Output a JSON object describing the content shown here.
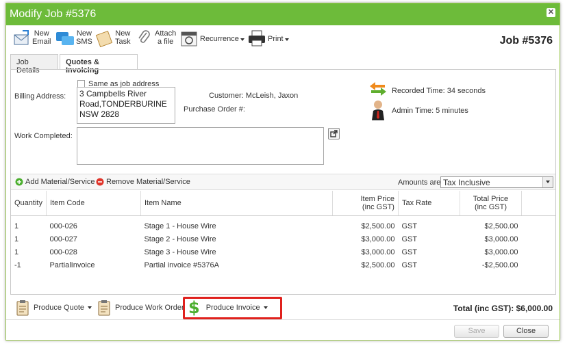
{
  "window": {
    "title": "Modify Job #5376",
    "close_symbol": "✕"
  },
  "toolbar": {
    "new_email": [
      "New",
      "Email"
    ],
    "new_sms": [
      "New",
      "SMS"
    ],
    "new_task": [
      "New",
      "Task"
    ],
    "attach": [
      "Attach",
      "a file"
    ],
    "recurrence": "Recurrence",
    "print": "Print",
    "job_number": "Job #5376"
  },
  "tabs": [
    {
      "label": "Job Details"
    },
    {
      "label": "Quotes & Invoicing"
    }
  ],
  "form": {
    "same_as_job_address": "Same as job address",
    "billing_address_label": "Billing Address:",
    "billing_address_lines": [
      "3 Campbells River",
      "Road,TONDERBURINE",
      "NSW 2828"
    ],
    "customer": "Customer: McLeish, Jaxon",
    "purchase_order": "Purchase Order #:",
    "work_completed_label": "Work Completed:",
    "recorded_time": "Recorded Time: 34 seconds",
    "admin_time": "Admin Time: 5 minutes"
  },
  "materials": {
    "add": "Add Material/Service",
    "remove": "Remove Material/Service",
    "amounts_label": "Amounts are",
    "amounts_value": "Tax Inclusive"
  },
  "table": {
    "headers": {
      "quantity": "Quantity",
      "item_code": "Item Code",
      "item_name": "Item Name",
      "item_price_1": "Item Price",
      "item_price_2": "(inc GST)",
      "tax_rate": "Tax Rate",
      "total_price_1": "Total Price",
      "total_price_2": "(inc GST)"
    },
    "rows": [
      {
        "qty": "1",
        "code": "000-026",
        "name": "Stage 1 - House Wire",
        "price": "$2,500.00",
        "tax": "GST",
        "total": "$2,500.00"
      },
      {
        "qty": "1",
        "code": "000-027",
        "name": "Stage 2 - House Wire",
        "price": "$3,000.00",
        "tax": "GST",
        "total": "$3,000.00"
      },
      {
        "qty": "1",
        "code": "000-028",
        "name": "Stage 3 - House Wire",
        "price": "$3,000.00",
        "tax": "GST",
        "total": "$3,000.00"
      },
      {
        "qty": "-1",
        "code": "PartialInvoice",
        "name": "Partial invoice #5376A",
        "price": "$2,500.00",
        "tax": "GST",
        "total": "-$2,500.00"
      }
    ]
  },
  "bottom": {
    "produce_quote": "Produce Quote",
    "produce_work_order": "Produce Work Order",
    "produce_invoice": "Produce Invoice",
    "total": "Total (inc GST): $6,000.00"
  },
  "footer": {
    "save": "Save",
    "close": "Close"
  },
  "colors": {
    "titlebar": "#6dbb3a",
    "highlight": "#e0211d"
  }
}
